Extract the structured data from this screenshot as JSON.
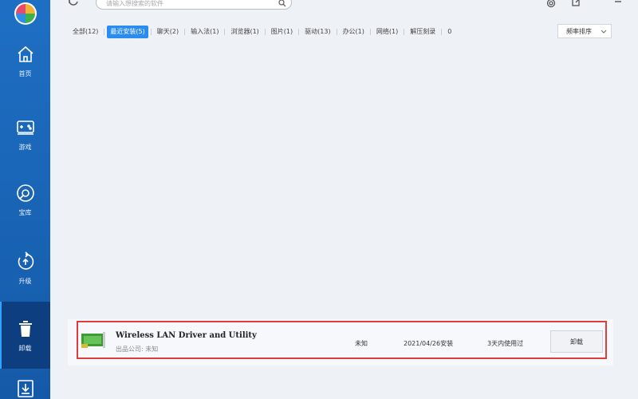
{
  "sidebar": {
    "items": [
      {
        "label": "首页",
        "icon": "home-icon"
      },
      {
        "label": "游戏",
        "icon": "gamepad-icon"
      },
      {
        "label": "宝库",
        "icon": "treasure-disc-icon"
      },
      {
        "label": "升级",
        "icon": "upgrade-icon"
      },
      {
        "label": "卸载",
        "icon": "trash-icon",
        "active": true
      },
      {
        "label": "",
        "icon": "download-icon"
      }
    ]
  },
  "search": {
    "placeholder": "请输入想搜索的软件"
  },
  "filters": {
    "tabs": [
      {
        "label": "全部(12)"
      },
      {
        "label": "最近安装(5)",
        "active": true
      },
      {
        "label": "聊天(2)"
      },
      {
        "label": "输入法(1)"
      },
      {
        "label": "浏览器(1)"
      },
      {
        "label": "图片(1)"
      },
      {
        "label": "驱动(13)"
      },
      {
        "label": "办公(1)"
      },
      {
        "label": "网络(1)"
      },
      {
        "label": "解压刻录"
      },
      {
        "label": "0"
      }
    ],
    "sort_label": "频率排序"
  },
  "app": {
    "name": "Wireless LAN Driver and Utility",
    "publisher_label": "出品公司:",
    "publisher_value": "未知",
    "size": "未知",
    "install_date": "2021/04/26安装",
    "usage": "3天内使用过",
    "uninstall_label": "卸载"
  },
  "colors": {
    "sidebar": "#1e6fc4",
    "sidebar_active": "#0d3f80",
    "tab_active": "#2a8cf0",
    "highlight": "#e03c3c"
  }
}
